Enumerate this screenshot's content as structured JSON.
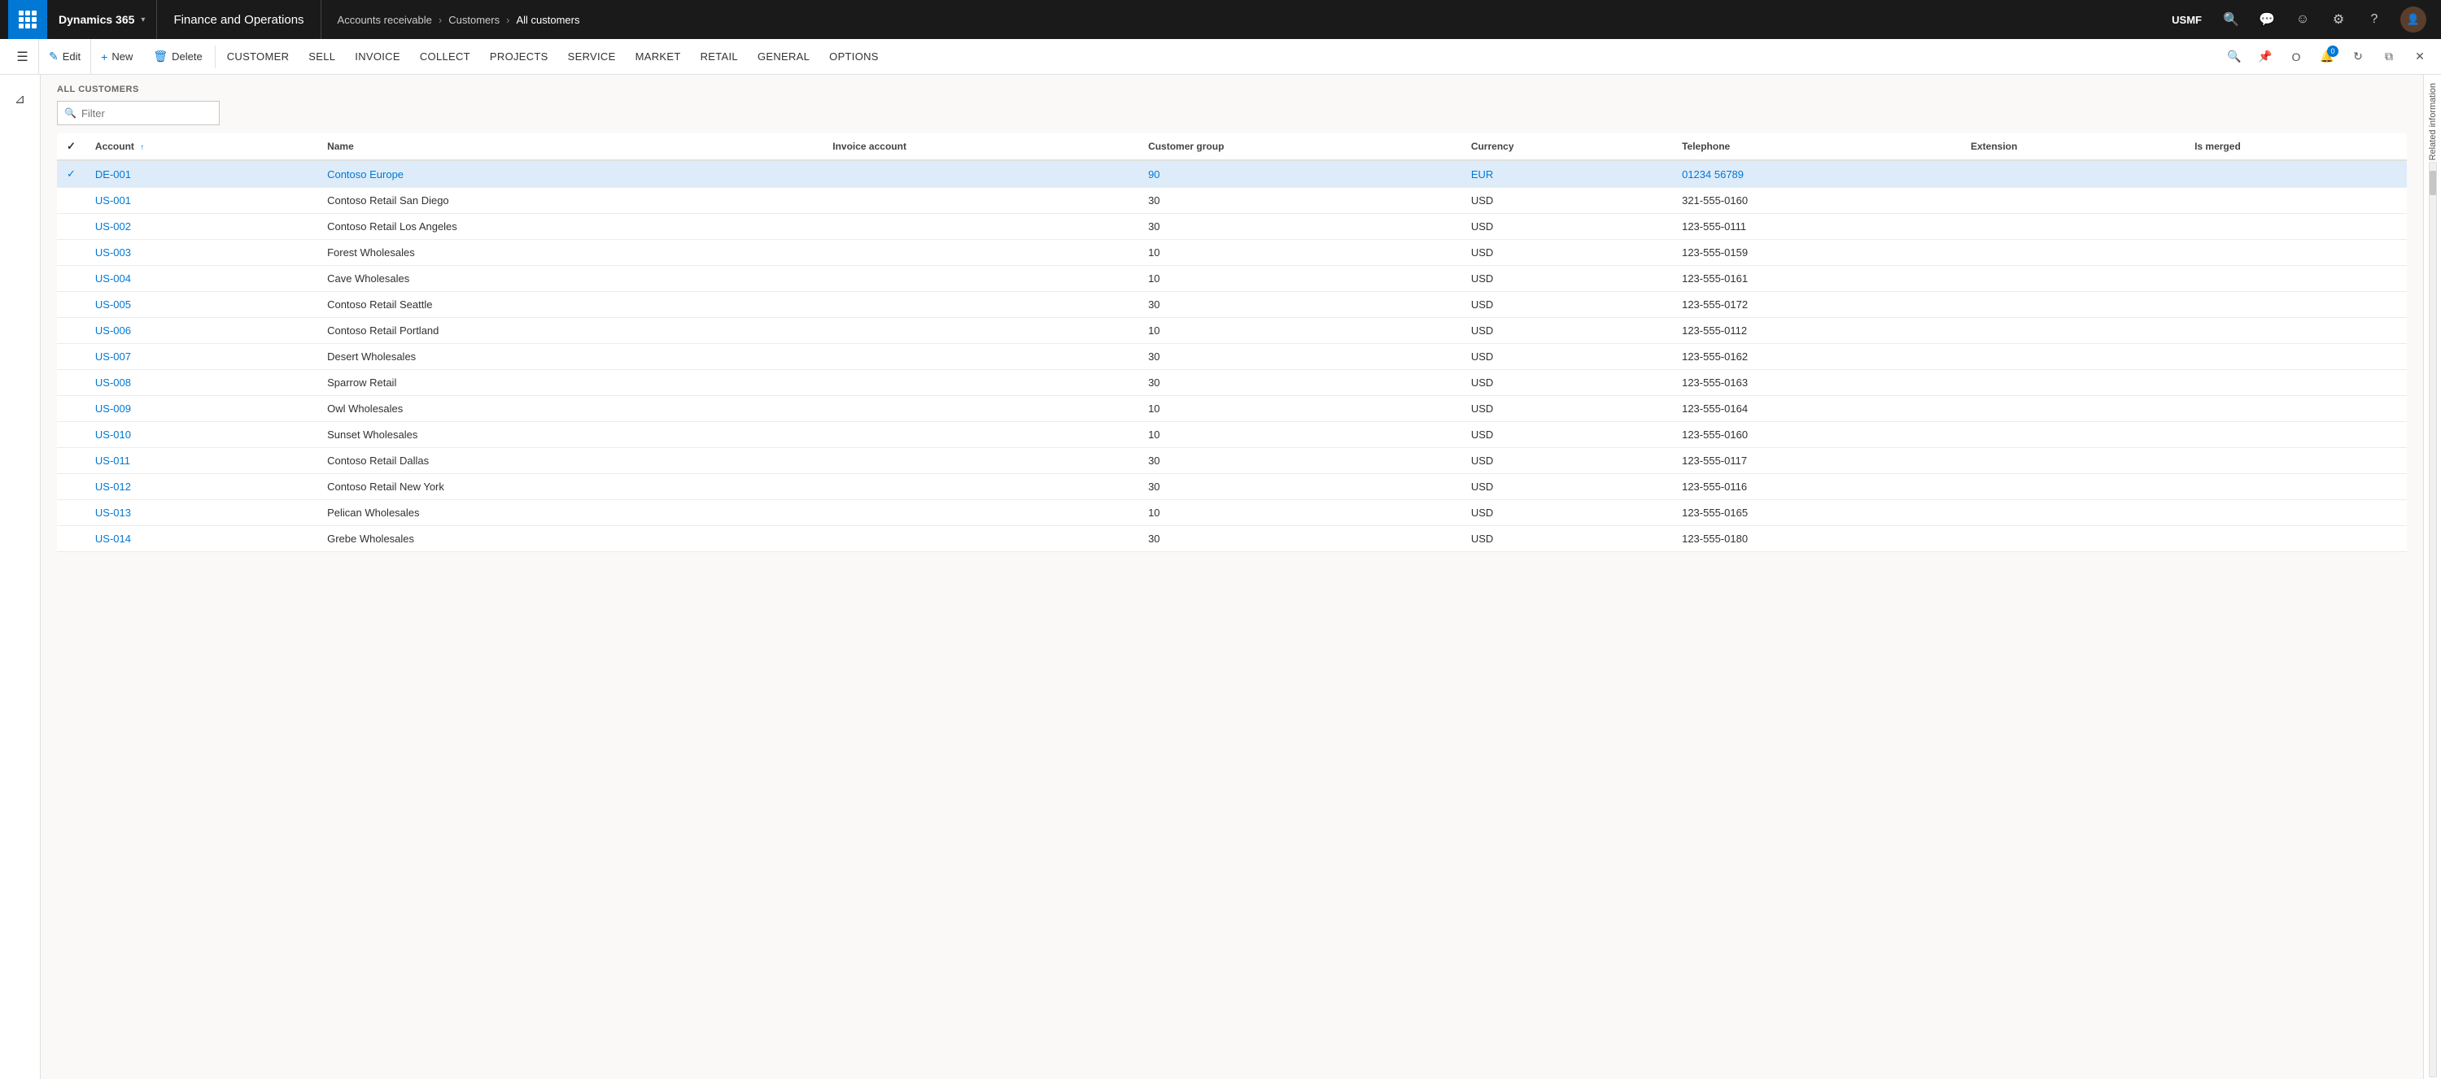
{
  "topNav": {
    "waffle_label": "Apps",
    "brand": "Dynamics 365",
    "app": "Finance and Operations",
    "breadcrumbs": [
      {
        "label": "Accounts receivable",
        "link": true
      },
      {
        "label": "Customers",
        "link": true
      },
      {
        "label": "All customers",
        "link": false
      }
    ],
    "company": "USMF",
    "icons": [
      "search",
      "message",
      "person",
      "settings",
      "help"
    ]
  },
  "actionBar": {
    "menu_toggle": "☰",
    "edit_btn": "Edit",
    "new_btn": "New",
    "delete_btn": "Delete",
    "menu_items": [
      "CUSTOMER",
      "SELL",
      "INVOICE",
      "COLLECT",
      "PROJECTS",
      "SERVICE",
      "MARKET",
      "RETAIL",
      "GENERAL",
      "OPTIONS"
    ],
    "right_icons": [
      "pin",
      "office",
      "notification",
      "refresh",
      "restore",
      "close"
    ]
  },
  "page": {
    "title": "ALL CUSTOMERS",
    "filter_placeholder": "Filter"
  },
  "table": {
    "columns": [
      {
        "key": "check",
        "label": ""
      },
      {
        "key": "account",
        "label": "Account",
        "sorted": true,
        "sort_dir": "asc"
      },
      {
        "key": "name",
        "label": "Name"
      },
      {
        "key": "invoice_account",
        "label": "Invoice account"
      },
      {
        "key": "customer_group",
        "label": "Customer group"
      },
      {
        "key": "currency",
        "label": "Currency"
      },
      {
        "key": "telephone",
        "label": "Telephone"
      },
      {
        "key": "extension",
        "label": "Extension"
      },
      {
        "key": "is_merged",
        "label": "Is merged"
      }
    ],
    "rows": [
      {
        "account": "DE-001",
        "name": "Contoso Europe",
        "invoice_account": "",
        "customer_group": "90",
        "currency": "EUR",
        "telephone": "01234 56789",
        "extension": "",
        "is_merged": "",
        "selected": true
      },
      {
        "account": "US-001",
        "name": "Contoso Retail San Diego",
        "invoice_account": "",
        "customer_group": "30",
        "currency": "USD",
        "telephone": "321-555-0160",
        "extension": "",
        "is_merged": ""
      },
      {
        "account": "US-002",
        "name": "Contoso Retail Los Angeles",
        "invoice_account": "",
        "customer_group": "30",
        "currency": "USD",
        "telephone": "123-555-0111",
        "extension": "",
        "is_merged": ""
      },
      {
        "account": "US-003",
        "name": "Forest Wholesales",
        "invoice_account": "",
        "customer_group": "10",
        "currency": "USD",
        "telephone": "123-555-0159",
        "extension": "",
        "is_merged": ""
      },
      {
        "account": "US-004",
        "name": "Cave Wholesales",
        "invoice_account": "",
        "customer_group": "10",
        "currency": "USD",
        "telephone": "123-555-0161",
        "extension": "",
        "is_merged": ""
      },
      {
        "account": "US-005",
        "name": "Contoso Retail Seattle",
        "invoice_account": "",
        "customer_group": "30",
        "currency": "USD",
        "telephone": "123-555-0172",
        "extension": "",
        "is_merged": ""
      },
      {
        "account": "US-006",
        "name": "Contoso Retail Portland",
        "invoice_account": "",
        "customer_group": "10",
        "currency": "USD",
        "telephone": "123-555-0112",
        "extension": "",
        "is_merged": ""
      },
      {
        "account": "US-007",
        "name": "Desert Wholesales",
        "invoice_account": "",
        "customer_group": "30",
        "currency": "USD",
        "telephone": "123-555-0162",
        "extension": "",
        "is_merged": ""
      },
      {
        "account": "US-008",
        "name": "Sparrow Retail",
        "invoice_account": "",
        "customer_group": "30",
        "currency": "USD",
        "telephone": "123-555-0163",
        "extension": "",
        "is_merged": ""
      },
      {
        "account": "US-009",
        "name": "Owl Wholesales",
        "invoice_account": "",
        "customer_group": "10",
        "currency": "USD",
        "telephone": "123-555-0164",
        "extension": "",
        "is_merged": ""
      },
      {
        "account": "US-010",
        "name": "Sunset Wholesales",
        "invoice_account": "",
        "customer_group": "10",
        "currency": "USD",
        "telephone": "123-555-0160",
        "extension": "",
        "is_merged": ""
      },
      {
        "account": "US-011",
        "name": "Contoso Retail Dallas",
        "invoice_account": "",
        "customer_group": "30",
        "currency": "USD",
        "telephone": "123-555-0117",
        "extension": "",
        "is_merged": ""
      },
      {
        "account": "US-012",
        "name": "Contoso Retail New York",
        "invoice_account": "",
        "customer_group": "30",
        "currency": "USD",
        "telephone": "123-555-0116",
        "extension": "",
        "is_merged": ""
      },
      {
        "account": "US-013",
        "name": "Pelican Wholesales",
        "invoice_account": "",
        "customer_group": "10",
        "currency": "USD",
        "telephone": "123-555-0165",
        "extension": "",
        "is_merged": ""
      },
      {
        "account": "US-014",
        "name": "Grebe Wholesales",
        "invoice_account": "",
        "customer_group": "30",
        "currency": "USD",
        "telephone": "123-555-0180",
        "extension": "",
        "is_merged": ""
      }
    ]
  },
  "rightPanel": {
    "label": "Related information"
  },
  "colors": {
    "accent": "#0078d4",
    "top_nav_bg": "#1a1a1a",
    "waffle_bg": "#0078d4",
    "selected_row": "#deecf9"
  }
}
